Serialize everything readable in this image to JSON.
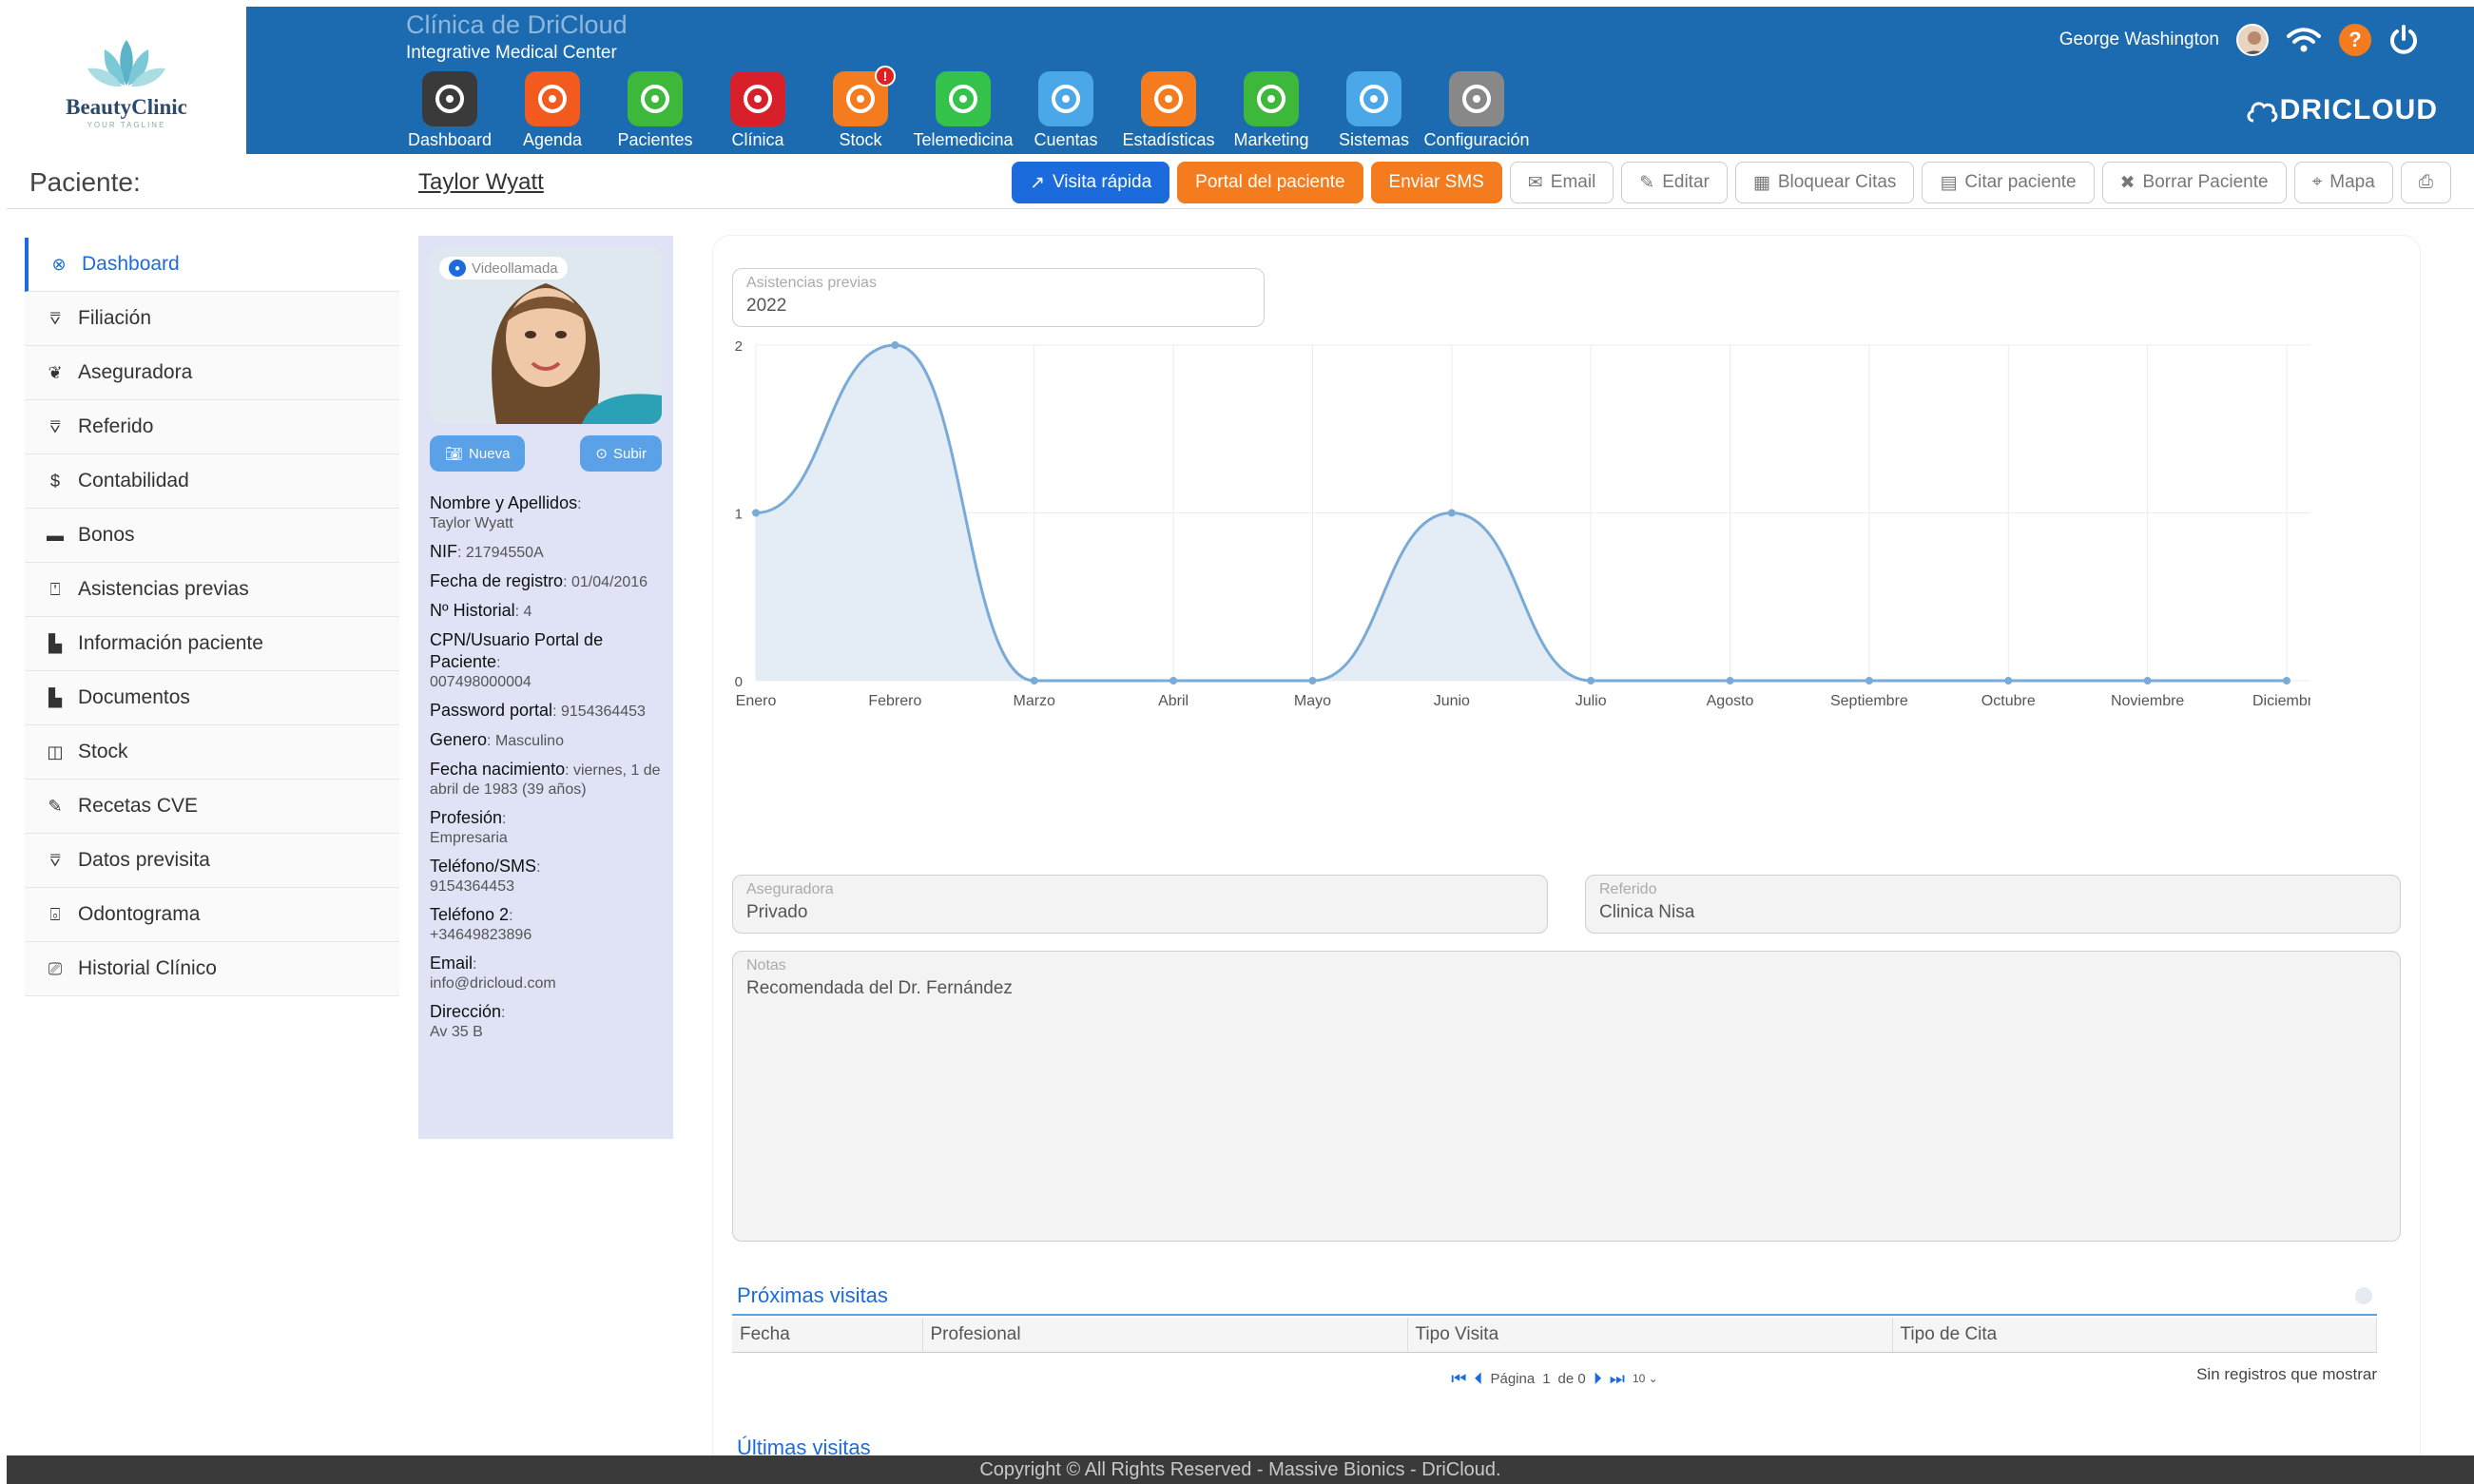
{
  "app": {
    "logo_name": "BeautyClinic",
    "logo_tagline": "YOUR TAGLINE",
    "clinic_name": "Clínica de DriCloud",
    "clinic_subtitle": "Integrative Medical Center",
    "user_name": "George Washington",
    "brand": "DRICLOUD"
  },
  "modules": [
    {
      "label": "Dashboard",
      "icon": "dashboard-gauge-icon",
      "color": "#3a3a3a"
    },
    {
      "label": "Agenda",
      "icon": "phone-calendar-icon",
      "color": "#f25a1e"
    },
    {
      "label": "Pacientes",
      "icon": "patient-icon",
      "color": "#3db83a"
    },
    {
      "label": "Clínica",
      "icon": "clipboard-icon",
      "color": "#d8202a"
    },
    {
      "label": "Stock",
      "icon": "box-icon",
      "color": "#f47c1e",
      "badge": "!"
    },
    {
      "label": "Telemedicina",
      "icon": "chat-bubble-icon",
      "color": "#34c24a"
    },
    {
      "label": "Cuentas",
      "icon": "coin-hand-icon",
      "color": "#4aa8e8"
    },
    {
      "label": "Estadísticas",
      "icon": "bar-chart-icon",
      "color": "#f47c1e"
    },
    {
      "label": "Marketing",
      "icon": "share-icon",
      "color": "#3db83a"
    },
    {
      "label": "Sistemas",
      "icon": "gear-icon",
      "color": "#4aa8e8"
    },
    {
      "label": "Configuración",
      "icon": "user-settings-icon",
      "color": "#888888"
    }
  ],
  "subheader": {
    "patient_label": "Paciente:",
    "patient_name": "Taylor Wyatt",
    "actions": [
      {
        "label": "Visita rápida",
        "style": "blue",
        "icon": "↗"
      },
      {
        "label": "Portal del paciente",
        "style": "orange",
        "icon": ""
      },
      {
        "label": "Enviar SMS",
        "style": "orange",
        "icon": ""
      },
      {
        "label": "Email",
        "style": "default",
        "icon": "✉"
      },
      {
        "label": "Editar",
        "style": "default",
        "icon": "✎"
      },
      {
        "label": "Bloquear Citas",
        "style": "default",
        "icon": "▦"
      },
      {
        "label": "Citar paciente",
        "style": "default",
        "icon": "▤"
      },
      {
        "label": "Borrar Paciente",
        "style": "default",
        "icon": "✖"
      },
      {
        "label": "Mapa",
        "style": "default",
        "icon": "⌖"
      },
      {
        "label": "",
        "style": "default",
        "icon": "⎙"
      }
    ]
  },
  "sidebar": {
    "items": [
      {
        "label": "Dashboard",
        "icon": "⊗",
        "active": true
      },
      {
        "label": "Filiación",
        "icon": "⩢"
      },
      {
        "label": "Aseguradora",
        "icon": "❦"
      },
      {
        "label": "Referido",
        "icon": "⩢"
      },
      {
        "label": "Contabilidad",
        "icon": "$"
      },
      {
        "label": "Bonos",
        "icon": "▬"
      },
      {
        "label": "Asistencias previas",
        "icon": "⍞"
      },
      {
        "label": "Información paciente",
        "icon": "▙"
      },
      {
        "label": "Documentos",
        "icon": "▙"
      },
      {
        "label": "Stock",
        "icon": "◫"
      },
      {
        "label": "Recetas CVE",
        "icon": "✎"
      },
      {
        "label": "Datos previsita",
        "icon": "⩢"
      },
      {
        "label": "Odontograma",
        "icon": "⌻"
      },
      {
        "label": "Historial Clínico",
        "icon": "⎚"
      }
    ]
  },
  "patient_card": {
    "video_call": "Videollamada",
    "btn_new": "Nueva",
    "btn_upload": "Subir",
    "fields": [
      {
        "label": "Nombre y Apellidos",
        "value": "Taylor Wyatt",
        "inline": false
      },
      {
        "label": "NIF",
        "value": "21794550A",
        "inline": true
      },
      {
        "label": "Fecha de registro",
        "value": "01/04/2016",
        "inline": true
      },
      {
        "label": "Nº Historial",
        "value": "4",
        "inline": true
      },
      {
        "label": "CPN/Usuario Portal de Paciente",
        "value": "007498000004",
        "inline": false
      },
      {
        "label": "Password portal",
        "value": "9154364453",
        "inline": true
      },
      {
        "label": "Genero",
        "value": "Masculino",
        "inline": true
      },
      {
        "label": "Fecha nacimiento",
        "value": "viernes, 1 de abril de 1983 (39 años)",
        "inline": true
      },
      {
        "label": "Profesión",
        "value": "Empresaria",
        "inline": false
      },
      {
        "label": "Teléfono/SMS",
        "value": "9154364453",
        "inline": false
      },
      {
        "label": "Teléfono 2",
        "value": "+34649823896",
        "inline": false
      },
      {
        "label": "Email",
        "value": "info@dricloud.com",
        "inline": false
      },
      {
        "label": "Dirección",
        "value": "Av 35 B",
        "inline": false
      }
    ]
  },
  "main": {
    "attendance_label": "Asistencias previas",
    "attendance_year": "2022",
    "insurer_label": "Aseguradora",
    "insurer_value": "Privado",
    "referral_label": "Referido",
    "referral_value": "Clinica Nisa",
    "notes_label": "Notas",
    "notes_value": "Recomendada del Dr. Fernández",
    "next_visits_title": "Próximas visitas",
    "next_visits_columns": [
      "Fecha",
      "Profesional",
      "Tipo Visita",
      "Tipo de Cita"
    ],
    "pager_page_label": "Página",
    "pager_page": "1",
    "pager_of": "de 0",
    "pager_size": "10",
    "no_records": "Sin registros que mostrar",
    "last_visits_title": "Últimas visitas"
  },
  "chart_data": {
    "type": "area",
    "categories": [
      "Enero",
      "Febrero",
      "Marzo",
      "Abril",
      "Mayo",
      "Junio",
      "Julio",
      "Agosto",
      "Septiembre",
      "Octubre",
      "Noviembre",
      "Diciembre"
    ],
    "values": [
      1,
      2,
      0,
      0,
      0,
      1,
      0,
      0,
      0,
      0,
      0,
      0
    ],
    "ylim": [
      0,
      2
    ],
    "yticks": [
      "0",
      "1",
      "2"
    ],
    "grid": true,
    "line_color": "#7aaad6",
    "fill_color": "#e4ecf6"
  },
  "footer": {
    "copyright": "Copyright © All Rights Reserved - Massive Bionics - DriCloud."
  }
}
